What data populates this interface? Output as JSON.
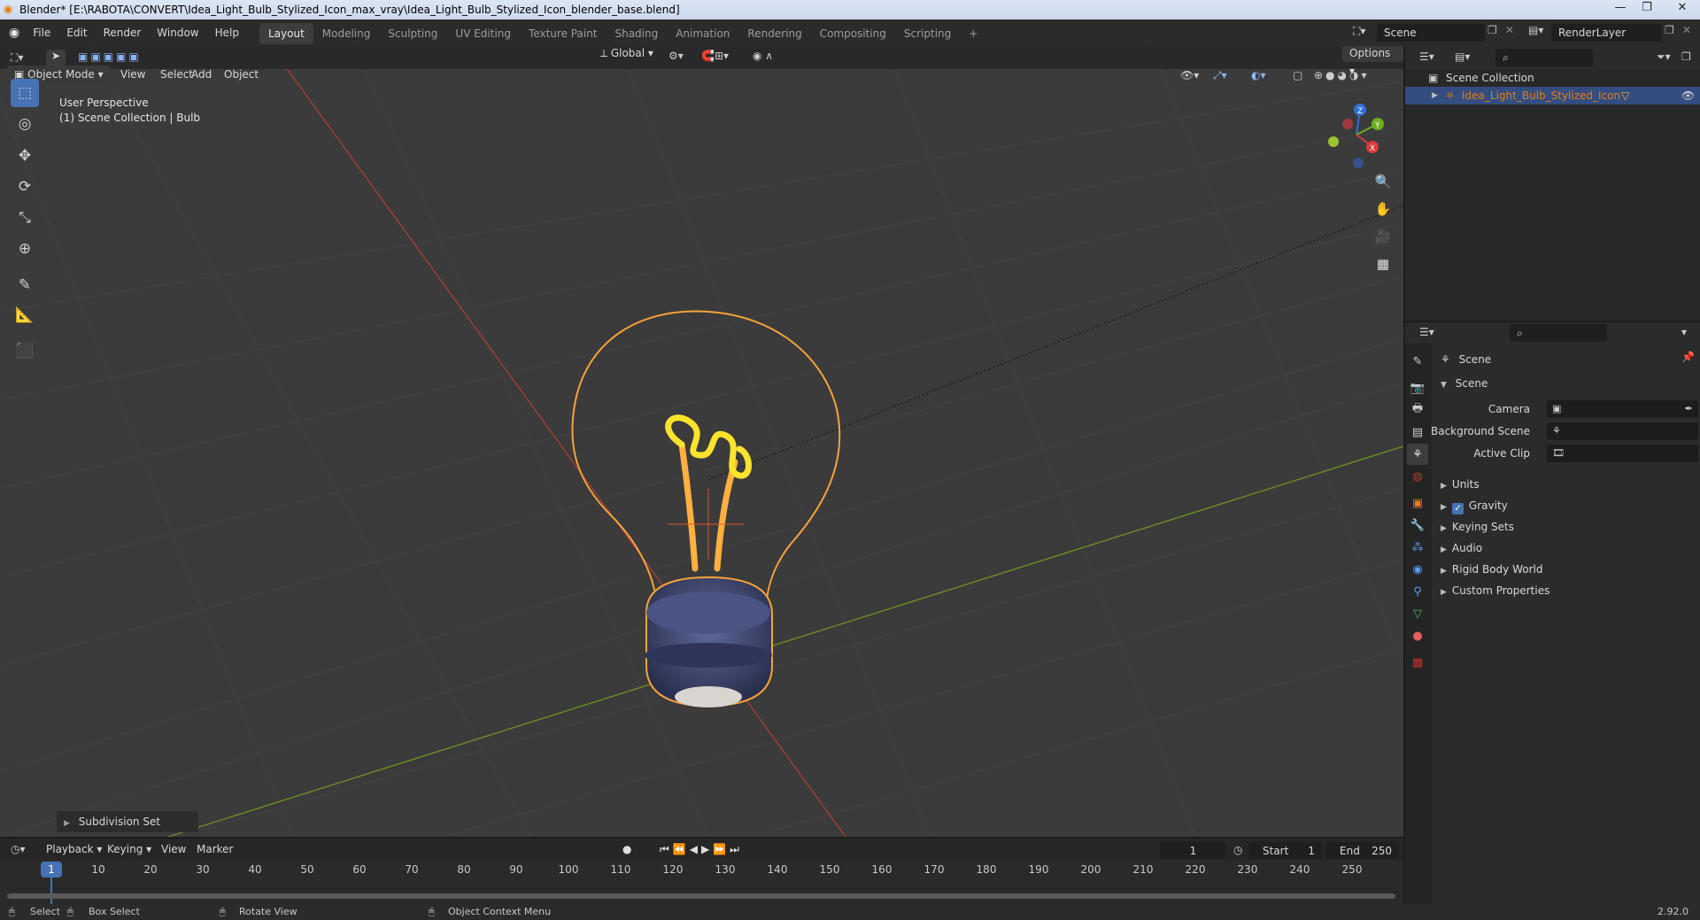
{
  "window": {
    "title": "Blender* [E:\\RABOTA\\CONVERT\\Idea_Light_Bulb_Stylized_Icon_max_vray\\Idea_Light_Bulb_Stylized_Icon_blender_base.blend]",
    "minimize": "—",
    "maximize": "❐",
    "close": "✕"
  },
  "menus": [
    "File",
    "Edit",
    "Render",
    "Window",
    "Help"
  ],
  "workspaces": [
    {
      "label": "Layout",
      "active": true
    },
    {
      "label": "Modeling"
    },
    {
      "label": "Sculpting"
    },
    {
      "label": "UV Editing"
    },
    {
      "label": "Texture Paint"
    },
    {
      "label": "Shading"
    },
    {
      "label": "Animation"
    },
    {
      "label": "Rendering"
    },
    {
      "label": "Compositing"
    },
    {
      "label": "Scripting"
    }
  ],
  "add_workspace": "+",
  "scene_field": "Scene",
  "render_layer_field": "RenderLayer",
  "viewport": {
    "mode": "Object Mode",
    "menus": [
      "View",
      "Select",
      "Add",
      "Object"
    ],
    "transform_orientation": "Global",
    "options": "Options",
    "overlay_line1": "User Perspective",
    "overlay_line2": "(1) Scene Collection | Bulb",
    "last_operator": "Subdivision Set",
    "gizmo_axes": {
      "x": "X",
      "y": "Y",
      "z": "Z"
    }
  },
  "tools": [
    {
      "name": "select-box-tool",
      "glyph": "⬚",
      "active": true
    },
    {
      "name": "cursor-tool",
      "glyph": "◎"
    },
    {
      "name": "move-tool",
      "glyph": "✥"
    },
    {
      "name": "rotate-tool",
      "glyph": "⟳"
    },
    {
      "name": "scale-tool",
      "glyph": "⤡"
    },
    {
      "name": "transform-tool",
      "glyph": "⊕"
    },
    {
      "name": "annotate-tool",
      "glyph": "✎"
    },
    {
      "name": "measure-tool",
      "glyph": "📐"
    },
    {
      "name": "add-cube-tool",
      "glyph": "⬛"
    }
  ],
  "outliner": {
    "root": "Scene Collection",
    "items": [
      {
        "label": "Idea_Light_Bulb_Stylized_Icon",
        "color": "#e87d0d"
      }
    ]
  },
  "properties": {
    "header": "Scene",
    "panel": "Scene",
    "camera_label": "Camera",
    "background_scene_label": "Background Scene",
    "active_clip_label": "Active Clip",
    "sections": [
      "Units",
      "Gravity",
      "Keying Sets",
      "Audio",
      "Rigid Body World",
      "Custom Properties"
    ],
    "gravity_checked": true
  },
  "timeline": {
    "menus": [
      "Playback",
      "Keying",
      "View",
      "Marker"
    ],
    "current_frame": "1",
    "start_label": "Start",
    "start_value": "1",
    "end_label": "End",
    "end_value": "250",
    "ruler_current": "1",
    "ticks": [
      "10",
      "20",
      "30",
      "40",
      "50",
      "60",
      "70",
      "80",
      "90",
      "100",
      "110",
      "120",
      "130",
      "140",
      "150",
      "160",
      "170",
      "180",
      "190",
      "200",
      "210",
      "220",
      "230",
      "240",
      "250"
    ]
  },
  "statusbar": {
    "select": "Select",
    "box_select": "Box Select",
    "rotate_view": "Rotate View",
    "context_menu": "Object Context Menu",
    "version": "2.92.0"
  },
  "colors": {
    "accent": "#4772b3",
    "outline": "#f7a23a",
    "selected_object": "#e87d0d"
  }
}
